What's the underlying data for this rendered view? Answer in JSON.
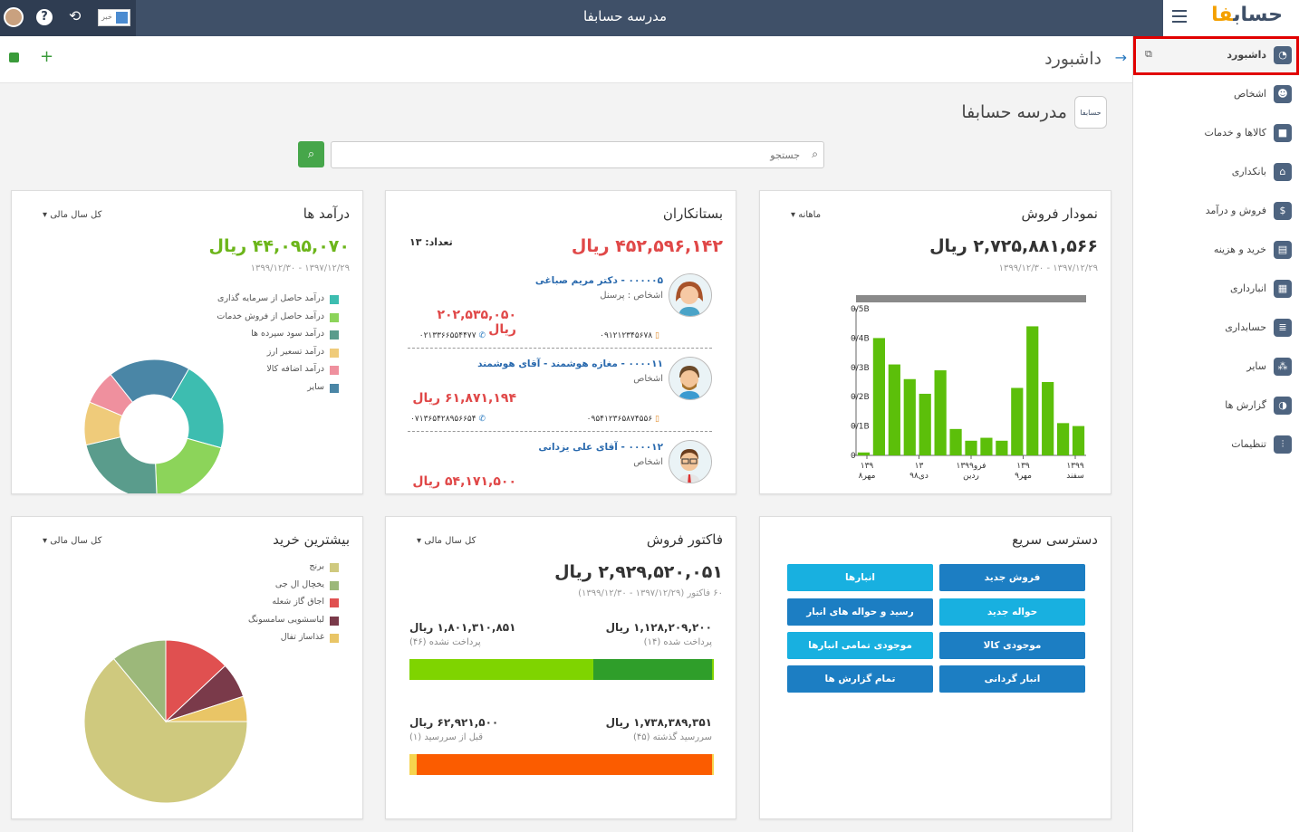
{
  "window_title": "مدرسه حسابفا",
  "brand": {
    "part1": "حساب",
    "part2": "فا"
  },
  "flag_text": "خبر",
  "sidebar": {
    "items": [
      {
        "label": "داشبورد",
        "icon": "gauge-icon",
        "active": true
      },
      {
        "label": "اشخاص",
        "icon": "people-icon"
      },
      {
        "label": "کالاها و خدمات",
        "icon": "box-icon"
      },
      {
        "label": "بانکداری",
        "icon": "bank-icon"
      },
      {
        "label": "فروش و درآمد",
        "icon": "sales-icon"
      },
      {
        "label": "خرید و هزینه",
        "icon": "purchase-icon"
      },
      {
        "label": "انبارداری",
        "icon": "warehouse-icon"
      },
      {
        "label": "حسابداری",
        "icon": "ledger-icon"
      },
      {
        "label": "سایر",
        "icon": "other-icon"
      },
      {
        "label": "گزارش ها",
        "icon": "report-icon"
      },
      {
        "label": "تنظیمات",
        "icon": "sliders-icon"
      }
    ]
  },
  "page": {
    "title": "داشبورد",
    "company_name": "مدرسه حسابفا",
    "company_logo_text": "حسابفا"
  },
  "search": {
    "placeholder": "جستجو"
  },
  "sales_chart": {
    "title": "نمودار فروش",
    "period": "ماهانه",
    "total": "۲,۷۲۵,۸۸۱,۵۶۶ ریال",
    "range": "۱۳۹۷/۱۲/۲۹ - ۱۳۹۹/۱۲/۳۰"
  },
  "chart_data": {
    "type": "bar",
    "ylim": [
      0,
      0.5
    ],
    "yticks": [
      "0",
      "0/1B",
      "0/2B",
      "0/3B",
      "0/4B",
      "0/5B"
    ],
    "xticks": [
      [
        "۱۳۹",
        "مهر۸"
      ],
      [
        "۱۳",
        "دی۹۸"
      ],
      [
        "فرو۱۳۹۹",
        "ردین"
      ],
      [
        "۱۳۹",
        "مهر۹"
      ],
      [
        "۱۳۹۹",
        "سفند"
      ]
    ],
    "values": [
      0.01,
      0.4,
      0.31,
      0.26,
      0.21,
      0.29,
      0.09,
      0.05,
      0.06,
      0.05,
      0.23,
      0.44,
      0.25,
      0.11,
      0.1
    ]
  },
  "creditors": {
    "title": "بستانکاران",
    "total": "۴۵۲,۵۹۶,۱۴۲ ریال",
    "count": "تعداد: ۱۳",
    "items": [
      {
        "name": "۰۰۰۰۰۵ - دکتر مریم صباغی",
        "sub": "اشخاص : پرسنل",
        "amount": "۲۰۲,۵۳۵,۰۵۰ ریال",
        "phone1": "۰۹۱۲۱۲۳۴۵۶۷۸",
        "phone2": "۰۲۱۳۳۶۶۵۵۴۴۷۷"
      },
      {
        "name": "۰۰۰۰۱۱ - مغازه هوشمند - آقای هوشمند",
        "sub": "اشخاص",
        "amount": "۶۱,۸۷۱,۱۹۴ ریال",
        "phone1": "۰۹۵۴۱۲۳۶۵۸۷۴۵۵۶",
        "phone2": "۰۷۱۳۶۵۴۲۸۹۵۶۶۵۴"
      },
      {
        "name": "۰۰۰۰۱۲ - آقای علی یزدانی",
        "sub": "اشخاص",
        "amount": "۵۴,۱۷۱,۵۰۰ ریال"
      }
    ]
  },
  "income": {
    "title": "درآمد ها",
    "period": "کل سال مالی",
    "total": "۴۴,۰۹۵,۰۷۰ ریال",
    "range": "۱۳۹۷/۱۲/۲۹ - ۱۳۹۹/۱۲/۳۰",
    "legend": [
      {
        "label": "درآمد حاصل از سرمایه گذاری",
        "color": "#3dbdb0"
      },
      {
        "label": "درآمد حاصل از فروش خدمات",
        "color": "#8cd45a"
      },
      {
        "label": "درآمد سود سپرده ها",
        "color": "#5a9c8c"
      },
      {
        "label": "درآمد تسعیر ارز",
        "color": "#efcb7a"
      },
      {
        "label": "درآمد اضافه کالا",
        "color": "#ef909e"
      },
      {
        "label": "سایر",
        "color": "#4a86a6"
      }
    ],
    "slices": [
      0.21,
      0.2,
      0.22,
      0.1,
      0.08,
      0.19
    ]
  },
  "quick_access": {
    "title": "دسترسی سریع",
    "buttons": [
      "فروش جدید",
      "انبارها",
      "حواله جدید",
      "رسید و حواله های انبار",
      "موجودی کالا",
      "موجودی تمامی انبارها",
      "انبار گردانی",
      "تمام گزارش ها"
    ]
  },
  "invoices": {
    "title": "فاکتور فروش",
    "period": "کل سال مالی",
    "total": "۲,۹۲۹,۵۲۰,۰۵۱ ریال",
    "sub": "۶۰ فاکتور (۱۳۹۷/۱۲/۲۹ - ۱۳۹۹/۱۲/۳۰)",
    "paid_amount": "۱,۱۲۸,۲۰۹,۲۰۰ ریال",
    "paid_label": "پرداخت شده (۱۴)",
    "unpaid_amount": "۱,۸۰۱,۳۱۰,۸۵۱ ریال",
    "unpaid_label": "پرداخت نشده (۴۶)",
    "overdue_amount": "۱,۷۳۸,۳۸۹,۳۵۱ ریال",
    "overdue_label": "سررسید گذشته (۴۵)",
    "due_amount": "۶۲,۹۲۱,۵۰۰ ریال",
    "due_label": "قبل از سررسید (۱)",
    "paid_fraction": 0.39,
    "overdue_fraction": 0.97
  },
  "top_purchase": {
    "title": "بیشترین خرید",
    "period": "کل سال مالی",
    "legend": [
      {
        "label": "برنج",
        "color": "#cfc97e"
      },
      {
        "label": "یخچال ال جی",
        "color": "#9cb87a"
      },
      {
        "label": "اجاق گاز شعله",
        "color": "#e05050"
      },
      {
        "label": "لباسشویی سامسونگ",
        "color": "#7a3a4a"
      },
      {
        "label": "غذاساز تفال",
        "color": "#e9c566"
      }
    ],
    "slices": [
      0.64,
      0.11,
      0.13,
      0.07,
      0.05
    ]
  }
}
